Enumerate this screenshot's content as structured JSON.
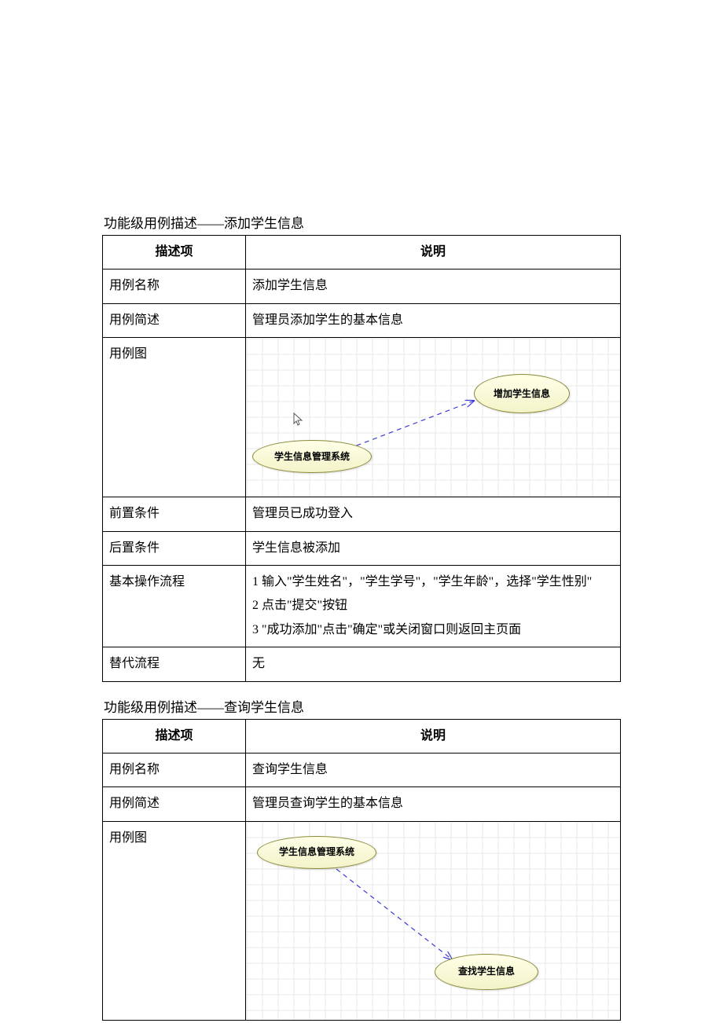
{
  "sections": [
    {
      "title": "功能级用例描述——添加学生信息",
      "headers": {
        "col1": "描述项",
        "col2": "说明"
      },
      "rows": {
        "name_label": "用例名称",
        "name_value": "添加学生信息",
        "brief_label": "用例简述",
        "brief_value": "管理员添加学生的基本信息",
        "diagram_label": "用例图",
        "diagram": {
          "node1": "学生信息管理系统",
          "node2": "增加学生信息"
        },
        "pre_label": "前置条件",
        "pre_value": "管理员已成功登入",
        "post_label": "后置条件",
        "post_value": "学生信息被添加",
        "flow_label": "基本操作流程",
        "flow_lines": [
          "1 输入\"学生姓名\"，\"学生学号\"，\"学生年龄\"，选择\"学生性别\"",
          "2 点击\"提交\"按钮",
          "3  \"成功添加\"点击\"确定\"或关闭窗口则返回主页面"
        ],
        "alt_label": "替代流程",
        "alt_value": "无"
      }
    },
    {
      "title": "功能级用例描述——查询学生信息",
      "headers": {
        "col1": "描述项",
        "col2": "说明"
      },
      "rows": {
        "name_label": "用例名称",
        "name_value": "查询学生信息",
        "brief_label": "用例简述",
        "brief_value": "管理员查询学生的基本信息",
        "diagram_label": "用例图",
        "diagram": {
          "node1": "学生信息管理系统",
          "node2": "查找学生信息"
        }
      }
    }
  ]
}
